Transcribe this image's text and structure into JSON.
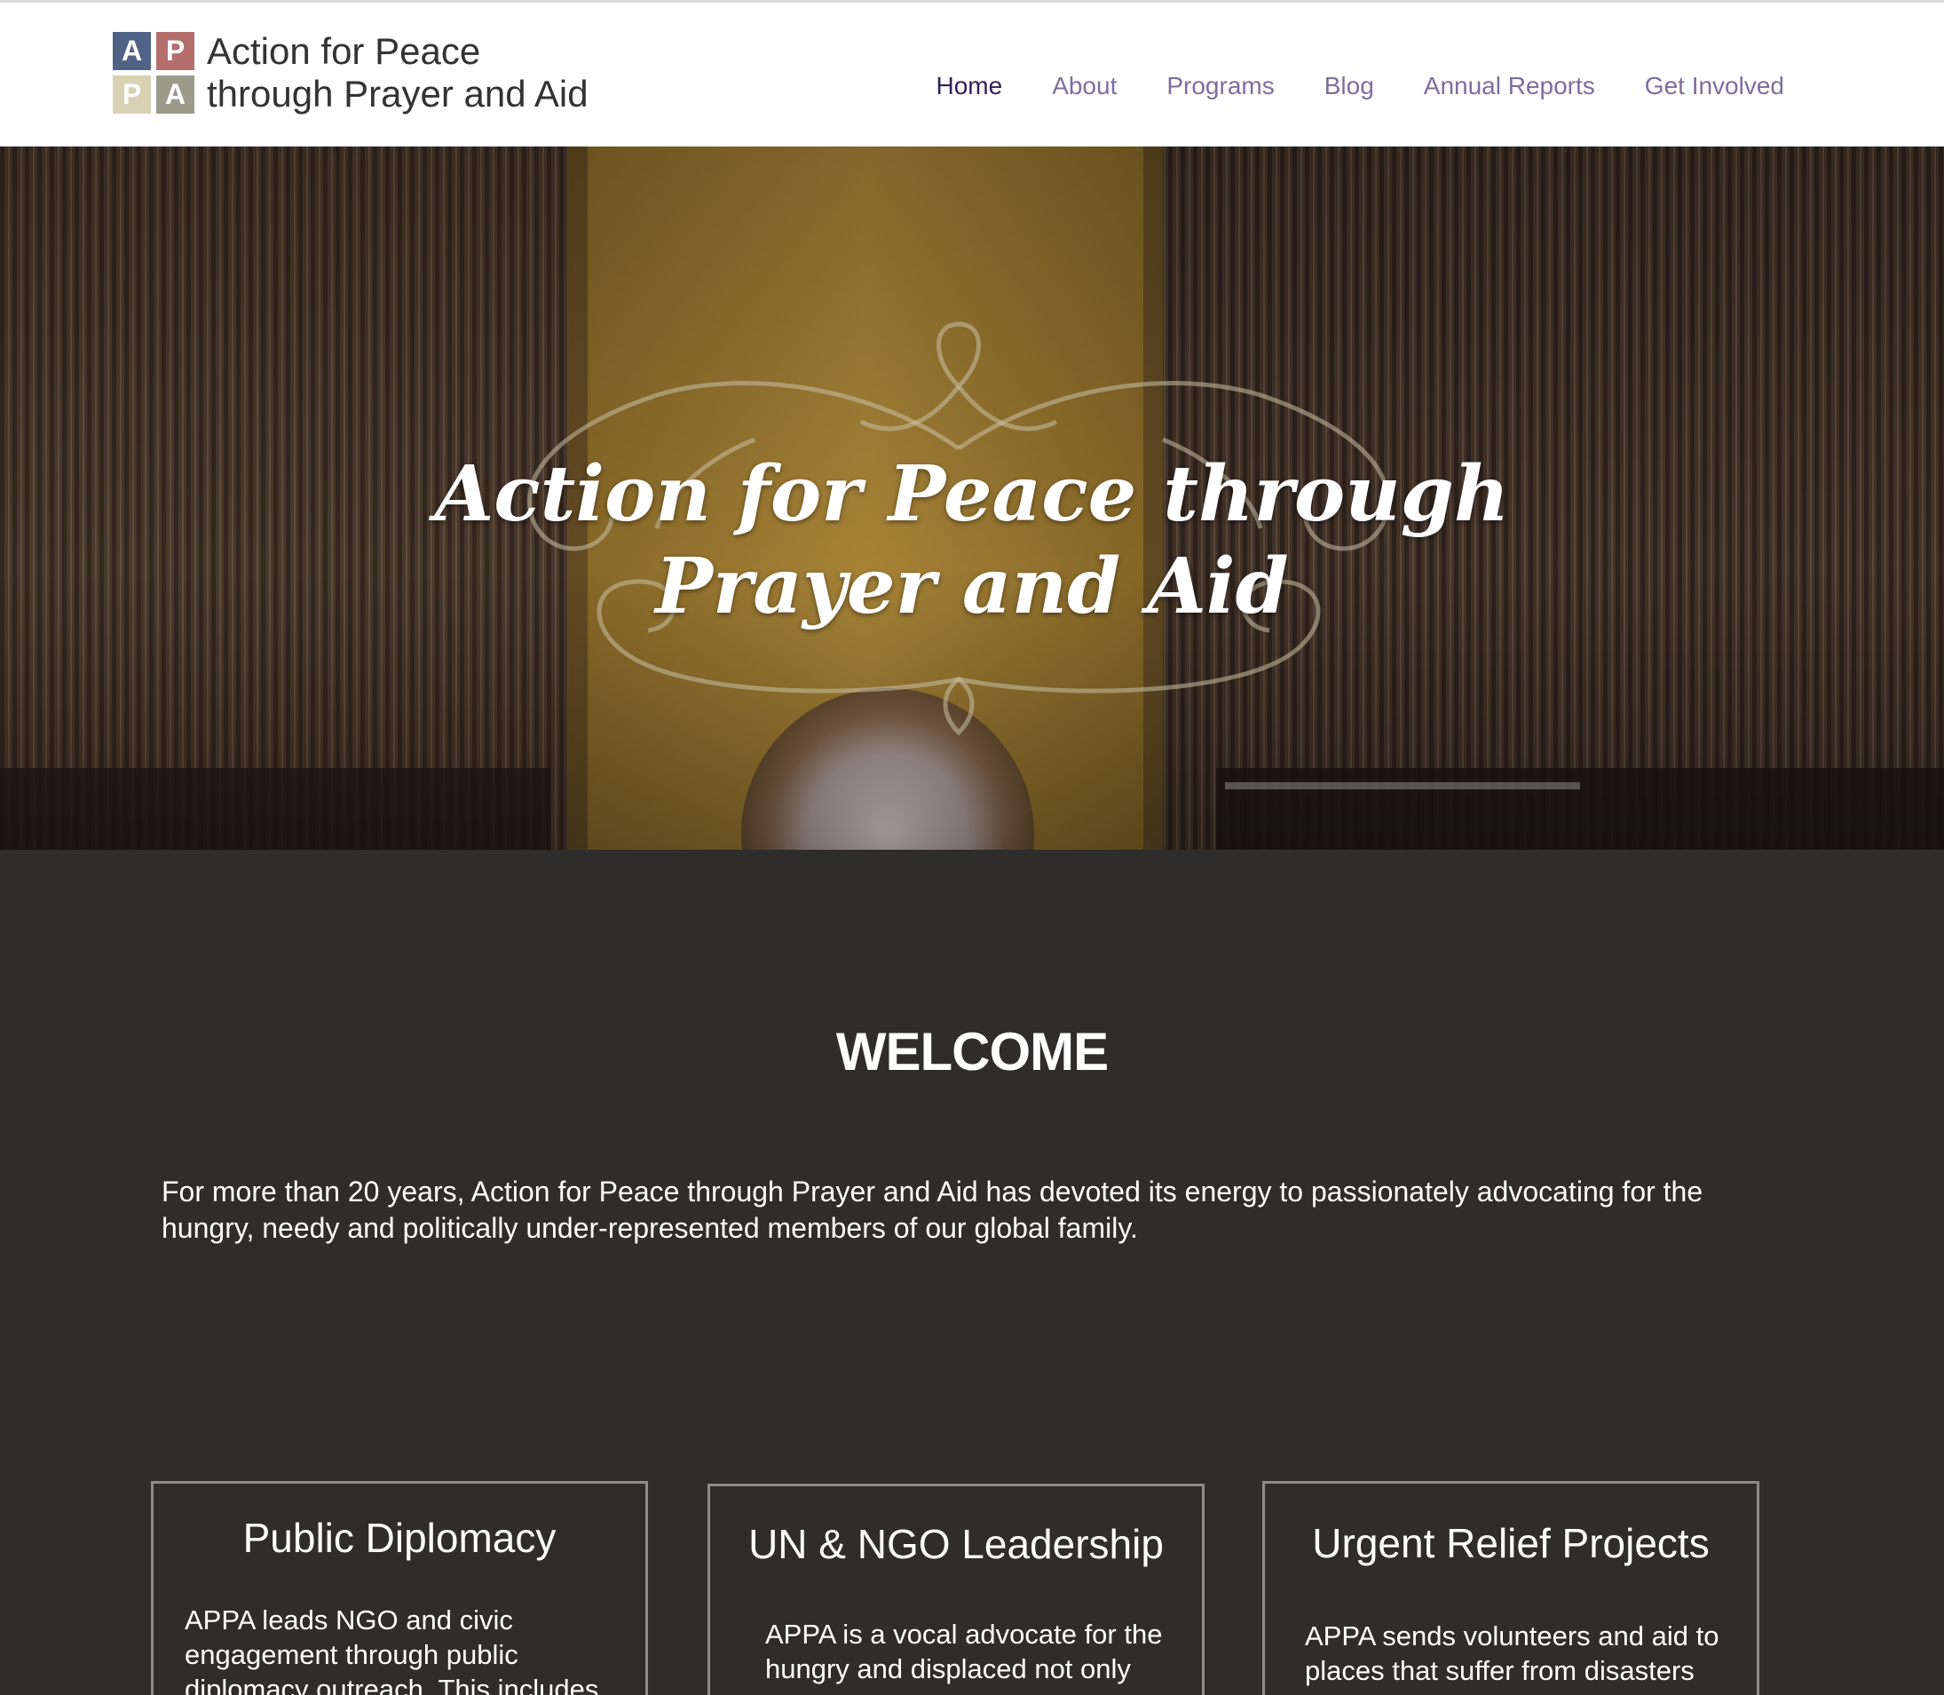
{
  "header": {
    "logo": {
      "letters": [
        "A",
        "P",
        "P",
        "A"
      ],
      "colors": [
        "#4f6386",
        "#b46f6d",
        "#d8d1b3",
        "#9b9b8c"
      ],
      "line1": "Action for Peace",
      "line2": "through Prayer and Aid"
    },
    "nav": [
      {
        "label": "Home",
        "active": true
      },
      {
        "label": "About"
      },
      {
        "label": "Programs"
      },
      {
        "label": "Blog"
      },
      {
        "label": "Annual Reports"
      },
      {
        "label": "Get Involved"
      }
    ]
  },
  "hero": {
    "title_line1": "Action for Peace through",
    "title_line2": "Prayer and Aid"
  },
  "welcome": {
    "title": "WELCOME",
    "text": "For more than 20 years, Action for Peace through Prayer and Aid has devoted its energy to passionately advocating for the hungry, needy and politically under-represented members of our global family."
  },
  "cards": [
    {
      "title": "Public Diplomacy",
      "text": "APPA leads NGO and civic engagement through public diplomacy outreach. This includes"
    },
    {
      "title": "UN & NGO Leadership",
      "text": "APPA  is a vocal advocate for the hungry and displaced not only"
    },
    {
      "title": "Urgent Relief Projects",
      "text": "APPA sends volunteers and aid to places that suffer from disasters"
    }
  ]
}
